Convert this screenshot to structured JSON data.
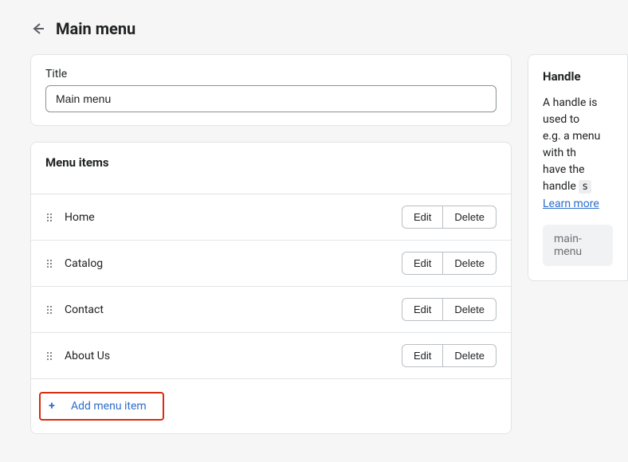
{
  "header": {
    "title": "Main menu"
  },
  "title_section": {
    "label": "Title",
    "value": "Main menu"
  },
  "menu_section": {
    "heading": "Menu items",
    "items": [
      {
        "label": "Home",
        "edit": "Edit",
        "delete": "Delete"
      },
      {
        "label": "Catalog",
        "edit": "Edit",
        "delete": "Delete"
      },
      {
        "label": "Contact",
        "edit": "Edit",
        "delete": "Delete"
      },
      {
        "label": "About Us",
        "edit": "Edit",
        "delete": "Delete"
      }
    ],
    "add_label": "Add menu item"
  },
  "handle_panel": {
    "title": "Handle",
    "body_1": "A handle is used to",
    "body_2": "e.g. a menu with th",
    "body_3": "have the handle",
    "code": "s",
    "learn_more": "Learn more",
    "value": "main-menu"
  }
}
